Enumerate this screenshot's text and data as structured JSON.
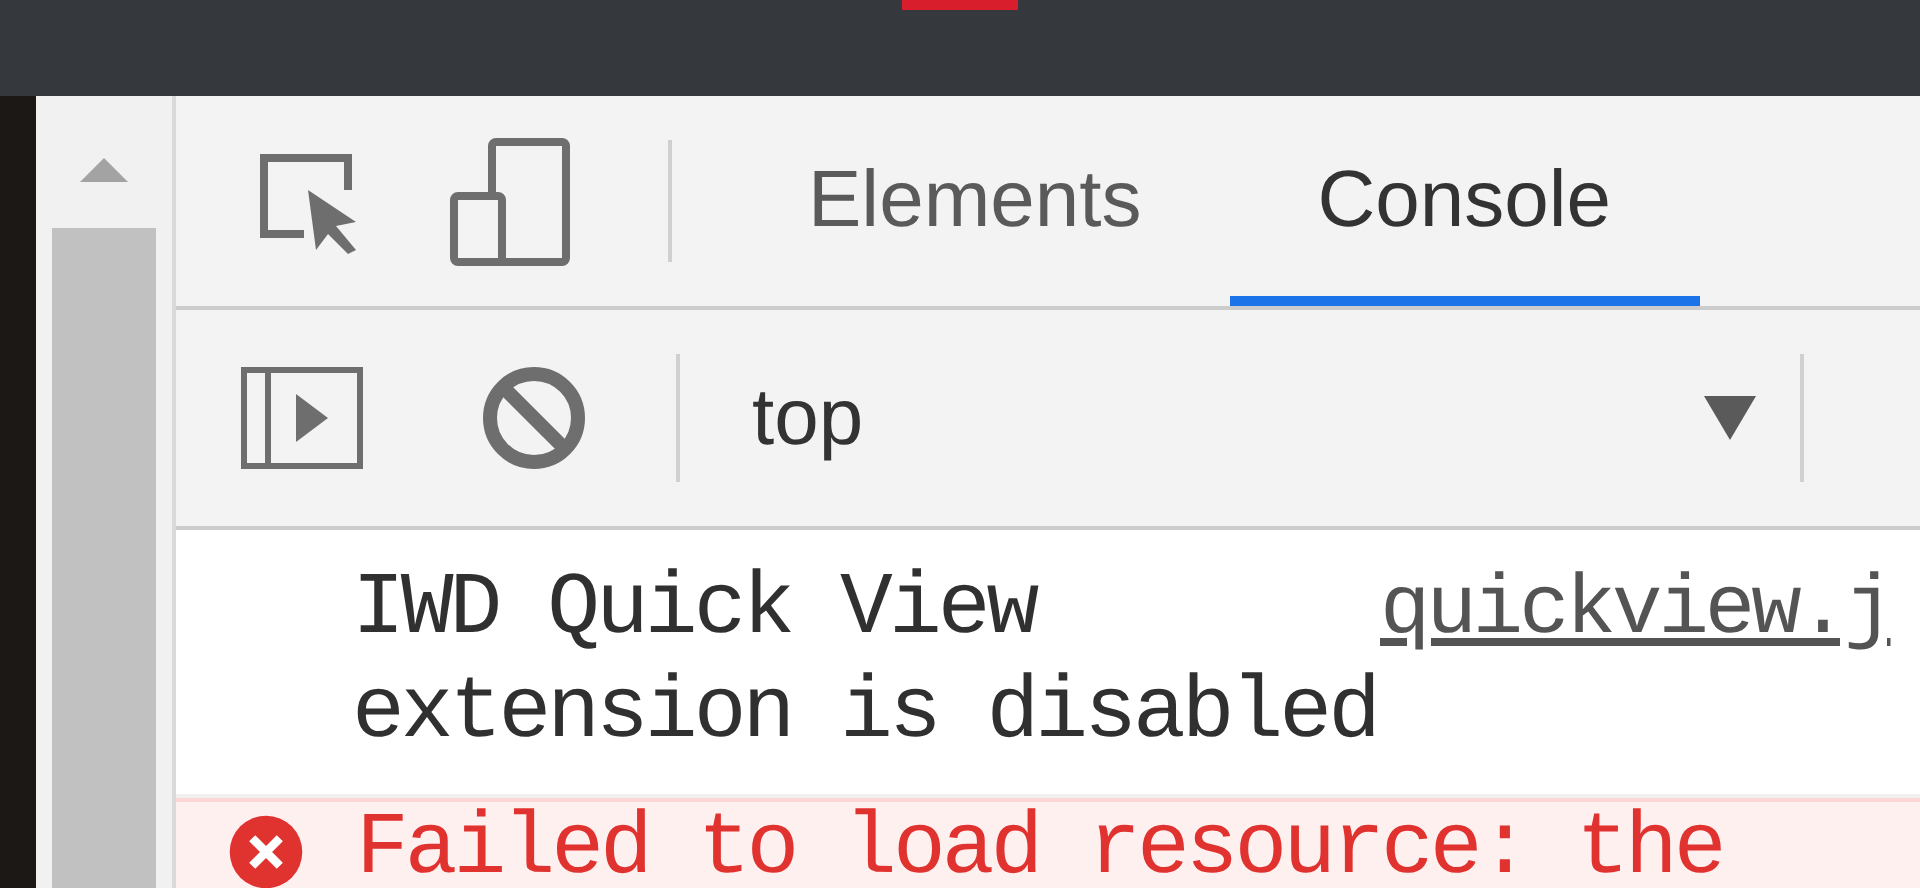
{
  "tabs": [
    {
      "label": "Elements",
      "selected": false
    },
    {
      "label": "Console",
      "selected": true
    }
  ],
  "context_selector": {
    "value": "top"
  },
  "messages": [
    {
      "kind": "info",
      "text": "IWD Quick View extension is disabled",
      "source": "quickview.j"
    },
    {
      "kind": "error",
      "text": "Failed to load resource: the"
    }
  ]
}
